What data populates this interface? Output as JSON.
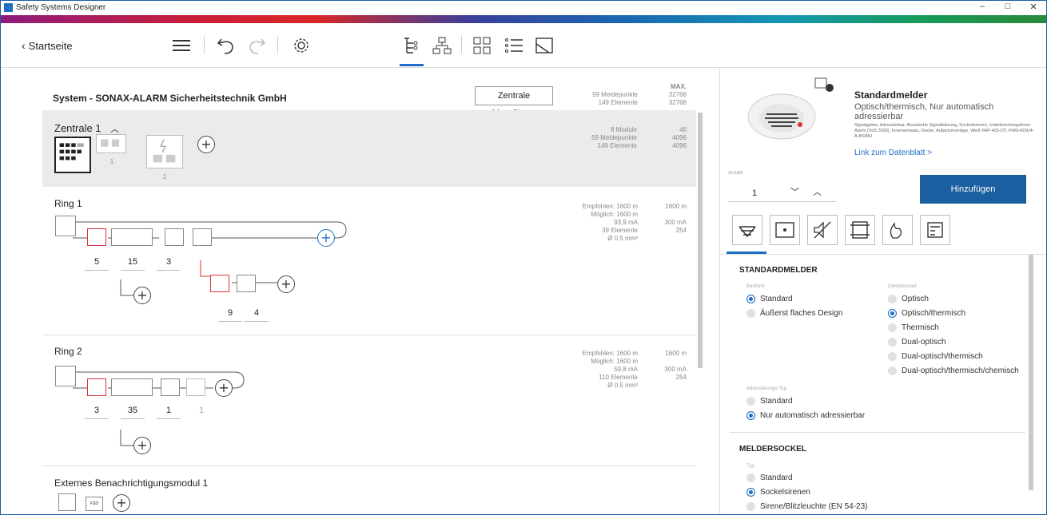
{
  "window": {
    "title": "Safety Systems Designer",
    "minimize": "–",
    "maximize": "□",
    "close": "✕"
  },
  "toolbar": {
    "back_label": "Startseite"
  },
  "system": {
    "title": "System - SONAX-ALARM Sicherheitstechnik GmbH",
    "add_central_label": "Zentrale hinzufügen",
    "stat_max_header": "MAX.",
    "stat_line1": "59 Meldepunkte",
    "stat_line2": "149 Elemente",
    "stat_max1": "32768",
    "stat_max2": "32768"
  },
  "zentrale": {
    "title": "Zentrale 1",
    "chevron": "^",
    "stat_line1": "8 Module",
    "stat_line2": "59 Meldepunkte",
    "stat_line3": "149 Elemente",
    "max1": "46",
    "max2": "4096",
    "max3": "4096",
    "count_a": "1",
    "count_b": "1"
  },
  "rings": [
    {
      "title": "Ring 1",
      "stat_lines": [
        "Empfohlen: 1600 m",
        "Möglich: 1600 m",
        "93,9 mA",
        "39 Elemente",
        "Ø 0,5 mm²"
      ],
      "max_lines": [
        "1600 m",
        "",
        "300 mA",
        "254",
        ""
      ],
      "counts": [
        "5",
        "15",
        "3"
      ],
      "sub_counts": [
        "9",
        "4"
      ]
    },
    {
      "title": "Ring 2",
      "stat_lines": [
        "Empfohlen: 1600 m",
        "Möglich: 1600 m",
        "59,8 mA",
        "110 Elemente",
        "Ø 0,5 mm²"
      ],
      "max_lines": [
        "1600 m",
        "",
        "300 mA",
        "254",
        ""
      ],
      "counts": [
        "3",
        "35",
        "1",
        "1"
      ]
    }
  ],
  "external": {
    "title": "Externes Benachrichtigungsmodul 1",
    "fsd": "FSD"
  },
  "product": {
    "title": "Standardmelder",
    "subtitle": "Optisch/thermisch, Nur automatisch adressierbar",
    "details": "Signalgeber, Adressierbar, Akustische Signalisierung, Sockelsirenen, Unterbrechungsfreier Alarm (VdS 3036), Innenseinsatz, Decke, Aufputzmontage, Weiß FAP-425-OT, FNM-420U4-A-BSWH",
    "link": "Link zum Datenblatt >",
    "anzahl_label": "Anzahl",
    "anzahl_value": "1",
    "add_label": "Hinzufügen"
  },
  "options": {
    "section1_title": "STANDARDMELDER",
    "bauform_label": "Bauform",
    "bauform": [
      "Standard",
      "Äußerst flaches Design"
    ],
    "detektion_label": "Detektionsart",
    "detektion": [
      "Optisch",
      "Optisch/thermisch",
      "Thermisch",
      "Dual-optisch",
      "Dual-optisch/thermisch",
      "Dual-optisch/thermisch/chemisch"
    ],
    "adress_label": "Adressierungs-Typ",
    "adress": [
      "Standard",
      "Nur automatisch adressierbar"
    ],
    "section2_title": "MELDERSOCKEL",
    "typ_label": "Typ",
    "sockel": [
      "Standard",
      "Sockelsirenen",
      "Sirene/Blitzleuchte (EN 54-23)"
    ]
  }
}
